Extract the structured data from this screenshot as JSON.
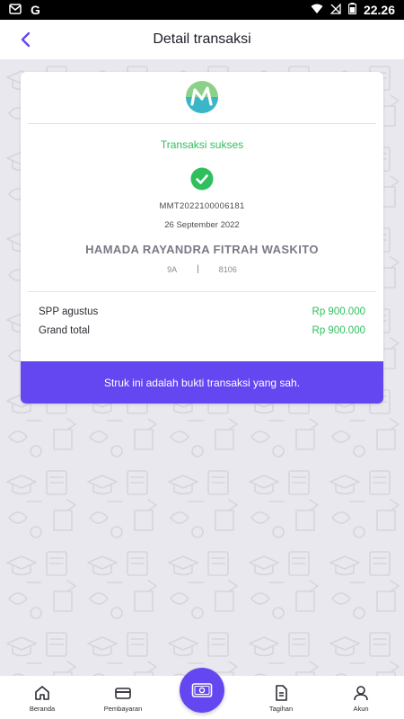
{
  "status_bar": {
    "time": "22.26"
  },
  "header": {
    "title": "Detail transaksi"
  },
  "receipt": {
    "status": "Transaksi sukses",
    "transaction_id": "MMT2022100006181",
    "date": "26 September 2022",
    "student_name": "HAMADA RAYANDRA FITRAH WASKITO",
    "class": "9A",
    "separator": "|",
    "student_number": "8106",
    "items": [
      {
        "label": "SPP agustus",
        "amount": "Rp 900.000"
      },
      {
        "label": "Grand total",
        "amount": "Rp 900.000"
      }
    ],
    "footer_note": "Struk ini adalah bukti transaksi yang sah."
  },
  "nav": {
    "items": [
      {
        "label": "Beranda",
        "icon": "home-icon"
      },
      {
        "label": "Pembayaran",
        "icon": "card-icon"
      },
      {
        "label": "Tagihan",
        "icon": "document-icon"
      },
      {
        "label": "Akun",
        "icon": "user-icon"
      }
    ],
    "center_icon": "money-icon"
  },
  "colors": {
    "accent": "#6547f2",
    "success": "#2fbf5e",
    "background": "#e9e8ee"
  }
}
